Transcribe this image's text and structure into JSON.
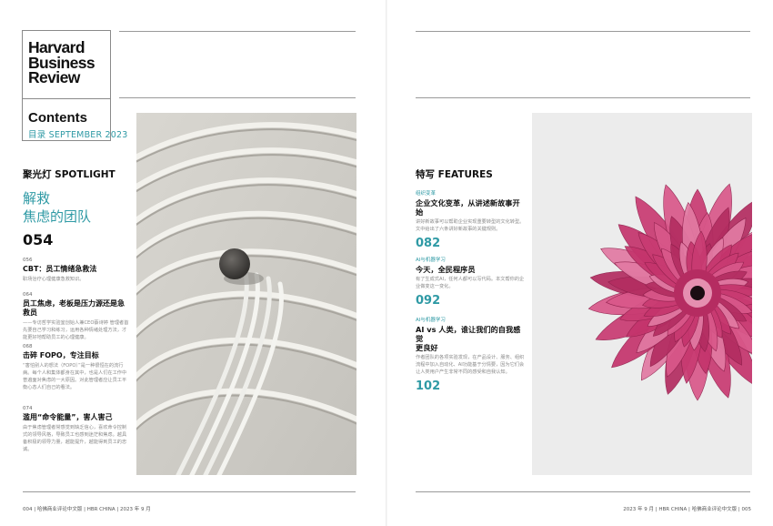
{
  "masthead": {
    "logo_line1": "Harvard",
    "logo_line2": "Business",
    "logo_line3": "Review",
    "contents_title": "Contents",
    "contents_date": "目录 SEPTEMBER 2023"
  },
  "left": {
    "section_label": "聚光灯 SPOTLIGHT",
    "feature_title_line1": "解救",
    "feature_title_line2": "焦虑的团队",
    "feature_number": "054",
    "entries": [
      {
        "page": "056",
        "title": "CBT：员工情绪急救法",
        "body": "职场治疗心理健康急救知识。"
      },
      {
        "page": "064",
        "title": "员工焦虑，老板是压力源还是急救员",
        "body": "——专访哲学实验室创始人兼CEO蔡诗婷 管理者首先要自己学习和练习，运用各种情绪处理方法，才能更好地帮助员工的心理健康。"
      },
      {
        "page": "068",
        "title": "击碎 FOPO，专注目标",
        "body": "“害怕别人的想法（FOPO）”是一种很恒在的流行病。每个人和集体都身在其中，也是人们在工作中普遍面对焦虑的一大原因。对此管理者应让员工平衡心态人们自己的看法。"
      },
      {
        "page": "074",
        "title": "滥用“命令能量”，害人害己",
        "body": "由于焦虑管理者常感觉到缺乏信心，喜欢命令控制式的领导风格，导致员工也感到迷茫和焦虑。越具备积极的领导力量，越能提升，越能得到员工的忠诚。"
      }
    ]
  },
  "right": {
    "section_label": "特写 FEATURES",
    "entries": [
      {
        "kicker": "组织变革",
        "title": "企业文化变革，从讲述新故事开始",
        "body": "讲好新故事可以帮助企业实现重要转型的文化转型。文中给出了六条讲好新故事的关键规则。",
        "number": "082"
      },
      {
        "kicker": "AI与机器学习",
        "title": "今天，全民程序员",
        "body": "有了生成式AI，任何人都可以写代码。本文帮你的企业做变这一变化。",
        "number": "092"
      },
      {
        "kicker": "AI与机器学习",
        "title_line1": "AI vs 人类，谁让我们的自我感觉",
        "title_line2": "更良好",
        "body": "作者团队的各项实验发现，在产品设计、服务、组织流程中加入自动化、AI功能基于分情要，因为它们会让人类用户产生非常不同的感受和自我认知。",
        "number": "102"
      }
    ]
  },
  "footer": {
    "left": "004 | 哈佛商业评论中文版 | HBR CHINA | 2023 年 9 月",
    "right": "2023 年 9 月 | HBR CHINA | 哈佛商业评论中文版 | 005"
  },
  "colors": {
    "accent": "#2f9aa5",
    "flower": "#c93b72",
    "sand": "#cfcdc7",
    "pink_bg": "#ececec"
  }
}
